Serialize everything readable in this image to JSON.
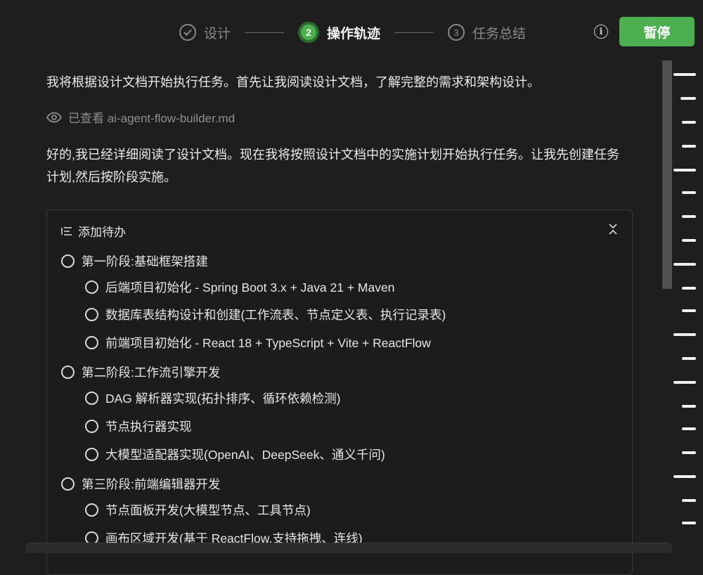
{
  "steps": [
    {
      "number": "✓",
      "label": "设计",
      "state": "done"
    },
    {
      "number": "2",
      "label": "操作轨迹",
      "state": "active"
    },
    {
      "number": "3",
      "label": "任务总结",
      "state": "pending"
    }
  ],
  "header": {
    "info_icon": "info-icon",
    "pause_label": "暂停",
    "accent_color": "#4caf50"
  },
  "messages": {
    "intro": "我将根据设计文档开始执行任务。首先让我阅读设计文档，了解完整的需求和架构设计。",
    "viewed_label": "已查看 ai-agent-flow-builder.md",
    "followup": "好的,我已经详细阅读了设计文档。现在我将按照设计文档中的实施计划开始执行任务。让我先创建任务计划,然后按阶段实施。"
  },
  "todo": {
    "title": "添加待办",
    "items": [
      {
        "label": "第一阶段:基础框架搭建",
        "level": 0
      },
      {
        "label": "后端项目初始化 - Spring Boot 3.x + Java 21 + Maven",
        "level": 1
      },
      {
        "label": "数据库表结构设计和创建(工作流表、节点定义表、执行记录表)",
        "level": 1
      },
      {
        "label": "前端项目初始化 - React 18 + TypeScript + Vite + ReactFlow",
        "level": 1
      },
      {
        "label": "第二阶段:工作流引擎开发",
        "level": 0
      },
      {
        "label": "DAG 解析器实现(拓扑排序、循环依赖检测)",
        "level": 1
      },
      {
        "label": "节点执行器实现",
        "level": 1
      },
      {
        "label": "大模型适配器实现(OpenAI、DeepSeek、通义千问)",
        "level": 1
      },
      {
        "label": "第三阶段:前端编辑器开发",
        "level": 0
      },
      {
        "label": "节点面板开发(大模型节点、工具节点)",
        "level": 1
      },
      {
        "label": "画布区域开发(基于 ReactFlow,支持拖拽、连线)",
        "level": 1
      }
    ]
  }
}
